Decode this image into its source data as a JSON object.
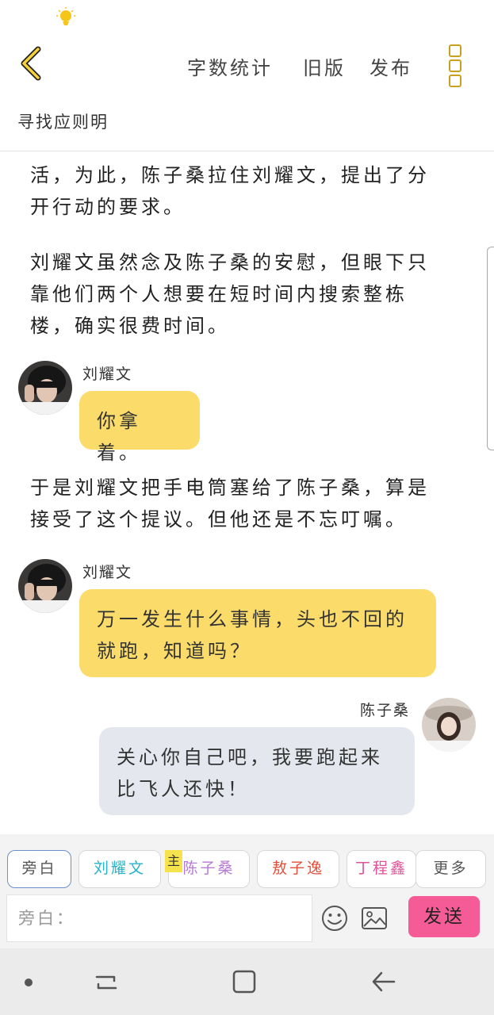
{
  "header": {
    "actions": [
      "字数统计",
      "旧版",
      "发布"
    ]
  },
  "story": {
    "title": "寻找应则明"
  },
  "content": {
    "para1": "活，为此，陈子桑拉住刘耀文，提出了分开行动的要求。",
    "para2": "刘耀文虽然念及陈子桑的安慰，但眼下只靠他们两个人想要在短时间内搜索整栋楼，确实很费时间。",
    "msg1": {
      "speaker": "刘耀文",
      "text": "你拿着。"
    },
    "para3": "于是刘耀文把手电筒塞给了陈子桑，算是接受了这个提议。但他还是不忘叮嘱。",
    "msg2": {
      "speaker": "刘耀文",
      "text": "万一发生什么事情，头也不回的就跑，知道吗？"
    },
    "msg3": {
      "speaker": "陈子桑",
      "text": "关心你自己吧，我要跑起来比飞人还快！"
    }
  },
  "characters": {
    "main_tag": "主",
    "items": [
      {
        "label": "旁白",
        "color": "#555555"
      },
      {
        "label": "刘耀文",
        "color": "#27b3c9"
      },
      {
        "label": "陈子桑",
        "color": "#b57ad6"
      },
      {
        "label": "敖子逸",
        "color": "#e0503a"
      },
      {
        "label": "丁程鑫",
        "color": "#e0509a"
      },
      {
        "label": "更多",
        "color": "#555555"
      }
    ]
  },
  "input": {
    "placeholder": "旁白：",
    "send_label": "发送"
  }
}
